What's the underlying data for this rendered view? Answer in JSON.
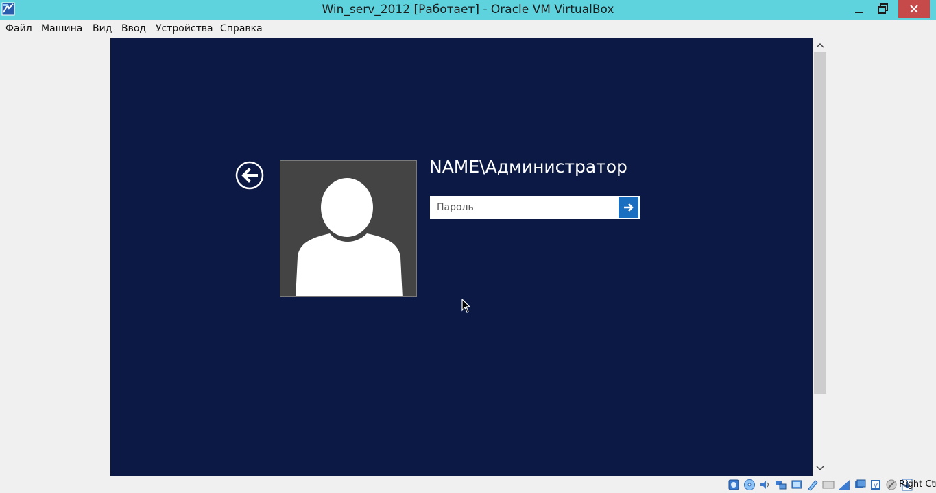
{
  "window": {
    "title": "Win_serv_2012 [Работает] - Oracle VM VirtualBox",
    "controls": [
      "minimize",
      "maximize",
      "close"
    ]
  },
  "menu": {
    "items": [
      "Файл",
      "Машина",
      "Вид",
      "Ввод",
      "Устройства",
      "Справка"
    ]
  },
  "vm": {
    "background_color": "#0b1944",
    "login": {
      "user_name": "NAME\\Администратор",
      "password_placeholder": "Пароль",
      "password_value": ""
    }
  },
  "statusbar": {
    "icons": [
      "hard-disk-icon",
      "optical-drive-icon",
      "audio-icon",
      "network-icon",
      "usb-icon",
      "shared-folders-icon",
      "display-icon",
      "video-capture-icon",
      "cpu-icon",
      "mouse-integration-icon",
      "keyboard-icon"
    ],
    "host_key": "Right Ctrl"
  },
  "colors": {
    "titlebar": "#5fd3dd",
    "close_button": "#c74a4a",
    "submit_button": "#1a6fc1"
  }
}
